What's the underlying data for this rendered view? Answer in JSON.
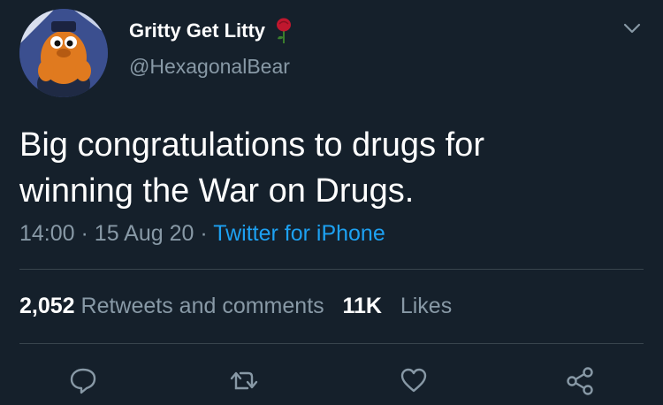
{
  "user": {
    "display_name": "Gritty Get Litty",
    "handle": "@HexagonalBear",
    "emoji": "rose-icon"
  },
  "tweet": {
    "text_line1": "Big congratulations to drugs for",
    "text_line2": "winning the War on Drugs."
  },
  "meta": {
    "time": "14:00",
    "separator": "·",
    "date": "15 Aug 20",
    "source": "Twitter for iPhone"
  },
  "stats": {
    "retweets_count": "2,052",
    "retweets_label": "Retweets and comments",
    "likes_count": "11K",
    "likes_label": "Likes"
  },
  "actions": [
    "reply-icon",
    "retweet-icon",
    "like-icon",
    "share-icon"
  ],
  "colors": {
    "background": "#15202b",
    "text": "#ffffff",
    "secondary": "#8899a6",
    "link": "#1da1f2",
    "divider": "#38444d"
  }
}
